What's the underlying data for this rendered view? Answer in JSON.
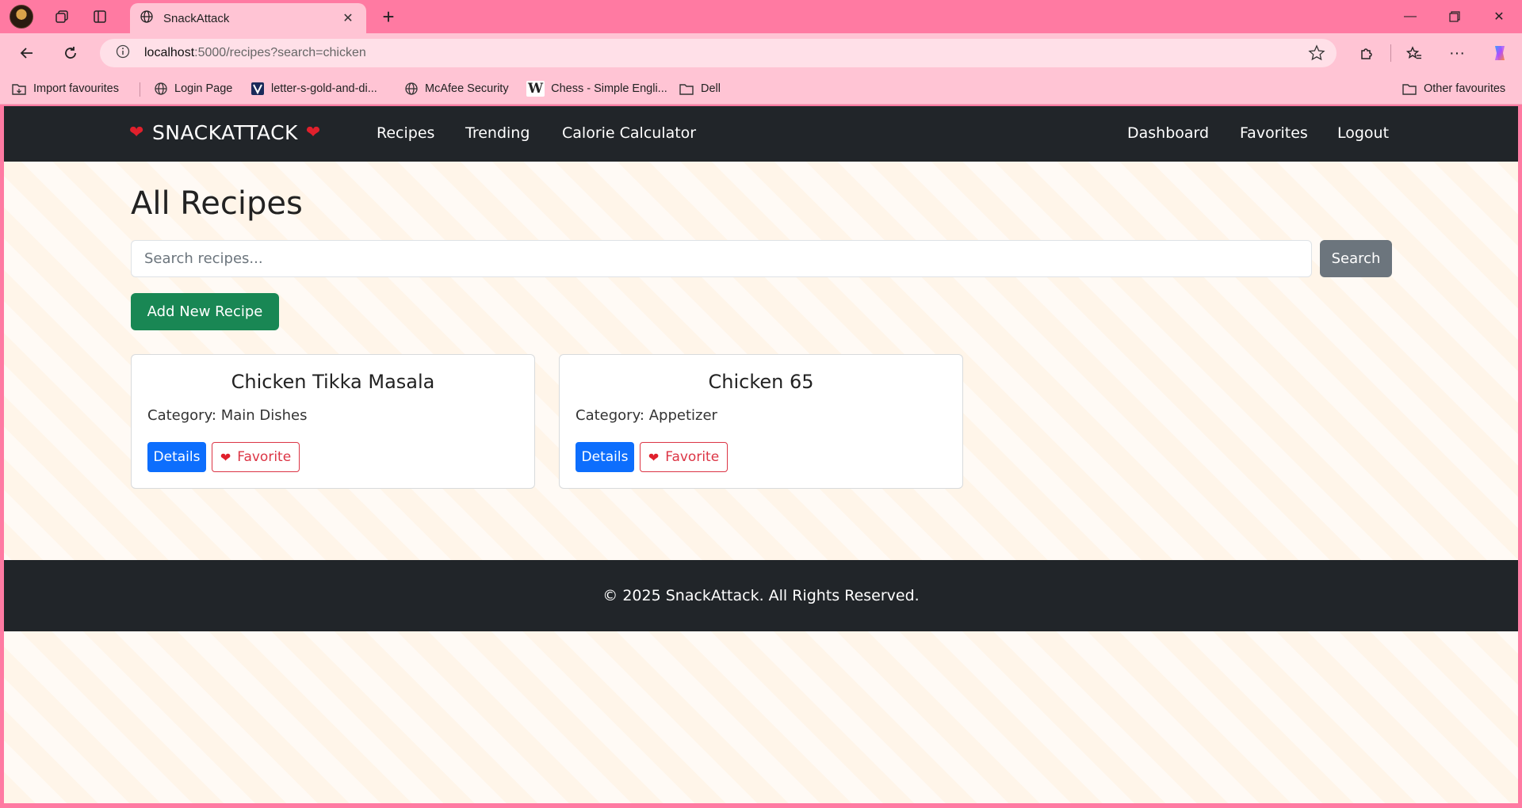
{
  "browser": {
    "tab_title": "SnackAttack",
    "url_host": "localhost",
    "url_rest": ":5000/recipes?search=chicken",
    "bookmarks": [
      {
        "label": "Import favourites",
        "icon": "import-icon"
      },
      {
        "label": "Login Page",
        "icon": "globe-icon"
      },
      {
        "label": "letter-s-gold-and-di...",
        "icon": "site-favicon"
      },
      {
        "label": "McAfee Security",
        "icon": "globe-icon"
      },
      {
        "label": "Chess - Simple Engli...",
        "icon": "wikipedia-icon"
      },
      {
        "label": "Dell",
        "icon": "folder-icon"
      }
    ],
    "other_favourites": "Other favourites"
  },
  "navbar": {
    "brand": "SNACKATTACK",
    "links_left": [
      "Recipes",
      "Trending",
      "Calorie Calculator"
    ],
    "links_right": [
      "Dashboard",
      "Favorites",
      "Logout"
    ]
  },
  "page": {
    "title": "All Recipes",
    "search_placeholder": "Search recipes...",
    "search_button": "Search",
    "add_button": "Add New Recipe"
  },
  "recipes": [
    {
      "title": "Chicken Tikka Masala",
      "category": "Category: Main Dishes",
      "details_label": "Details",
      "favorite_label": "Favorite"
    },
    {
      "title": "Chicken 65",
      "category": "Category: Appetizer",
      "details_label": "Details",
      "favorite_label": "Favorite"
    }
  ],
  "footer": {
    "text": "© 2025 SnackAttack. All Rights Reserved."
  },
  "colors": {
    "accent_green": "#198754",
    "accent_blue": "#0d6efd",
    "danger": "#dc3545",
    "navbar": "#212529",
    "chrome_pink": "#ff7aa2"
  }
}
